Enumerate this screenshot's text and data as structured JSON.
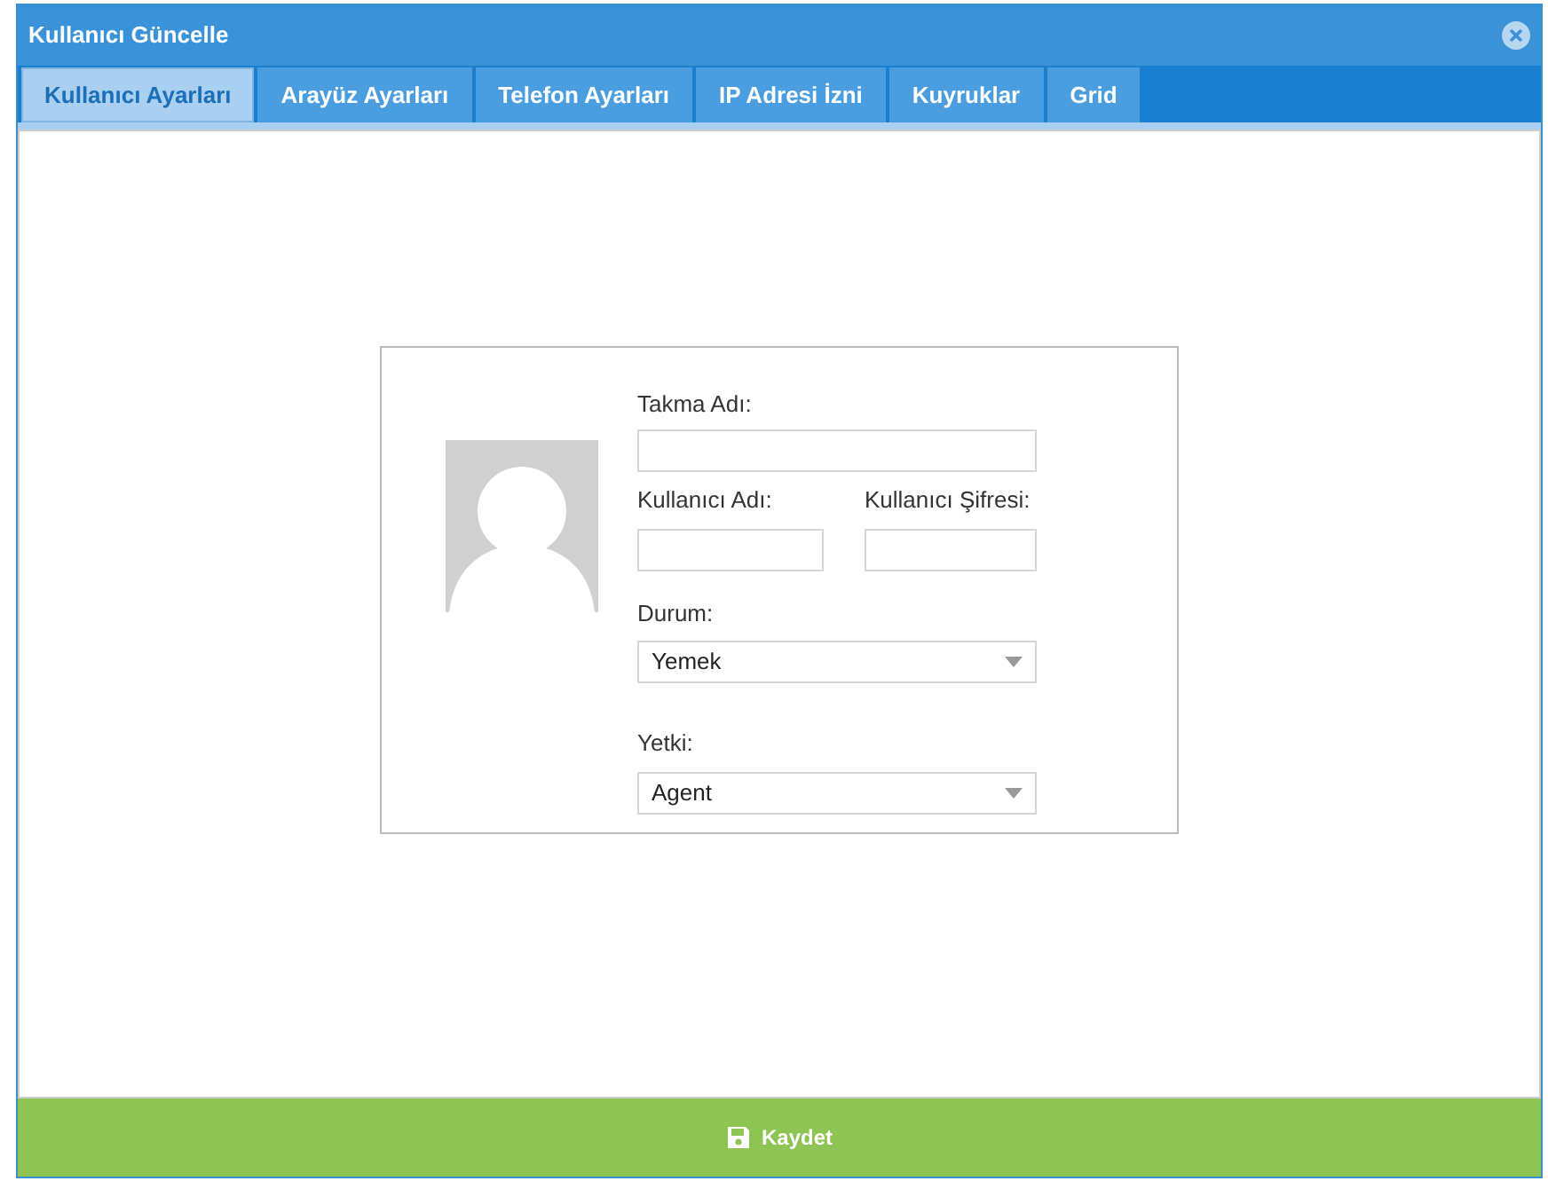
{
  "window": {
    "title": "Kullanıcı Güncelle"
  },
  "tabs": [
    {
      "label": "Kullanıcı Ayarları",
      "selected": true
    },
    {
      "label": "Arayüz Ayarları",
      "selected": false
    },
    {
      "label": "Telefon Ayarları",
      "selected": false
    },
    {
      "label": "IP Adresi İzni",
      "selected": false
    },
    {
      "label": "Kuyruklar",
      "selected": false
    },
    {
      "label": "Grid",
      "selected": false
    }
  ],
  "form": {
    "nickname": {
      "label": "Takma Adı:"
    },
    "username": {
      "label": "Kullanıcı Adı:"
    },
    "password": {
      "label": "Kullanıcı Şifresi:"
    },
    "status": {
      "label": "Durum:",
      "value": "Yemek"
    },
    "role": {
      "label": "Yetki:",
      "value": "Agent"
    }
  },
  "footer": {
    "save_button": "Kaydet"
  }
}
